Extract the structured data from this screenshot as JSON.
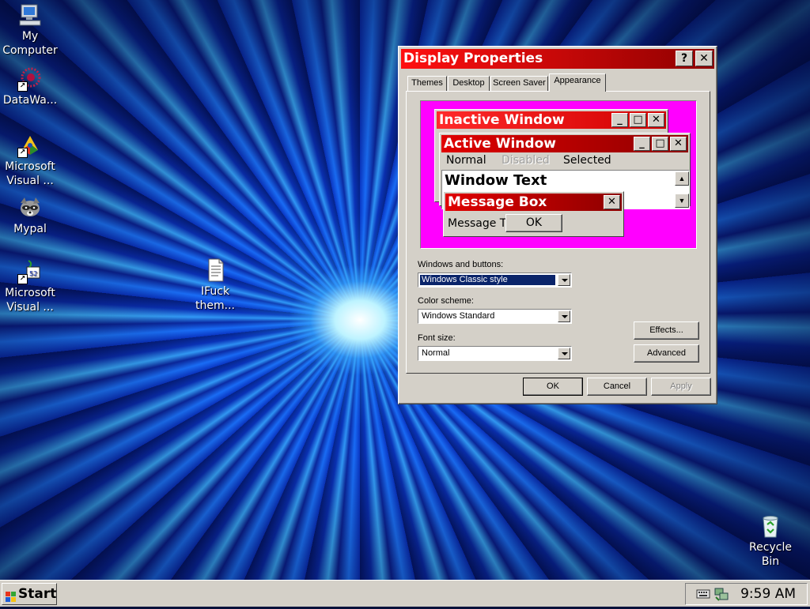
{
  "desktop": {
    "icons": [
      {
        "label": "My Computer",
        "icon": "my-computer-icon"
      },
      {
        "label": "DataWa...",
        "icon": "datawatch-icon"
      },
      {
        "label": "Microsoft Visual ...",
        "icon": "visual-studio-icon"
      },
      {
        "label": "Mypal",
        "icon": "mypal-raccoon-icon"
      },
      {
        "label": "Microsoft Visual ...",
        "icon": "visual-foxpro-icon"
      },
      {
        "label": "IFuck them...",
        "icon": "text-document-icon"
      },
      {
        "label": "Recycle Bin",
        "icon": "recycle-bin-icon"
      }
    ]
  },
  "dialog": {
    "title": "Display Properties",
    "help_btn": "?",
    "close_btn": "X",
    "tabs": [
      "Themes",
      "Desktop",
      "Screen Saver",
      "Appearance"
    ],
    "active_tab": "Appearance",
    "preview": {
      "inactive_title": "Inactive Window",
      "active_title": "Active Window",
      "menu_normal": "Normal",
      "menu_disabled": "Disabled",
      "menu_selected": "Selected",
      "window_text": "Window Text",
      "msgbox_title": "Message Box",
      "msgbox_text": "Message T",
      "msgbox_ok": "OK"
    },
    "windows_buttons_label": "Windows and buttons:",
    "windows_buttons_value": "Windows Classic style",
    "color_scheme_label": "Color scheme:",
    "color_scheme_value": "Windows Standard",
    "font_size_label": "Font size:",
    "font_size_value": "Normal",
    "effects_btn": "Effects...",
    "advanced_btn": "Advanced",
    "ok_btn": "OK",
    "cancel_btn": "Cancel",
    "apply_btn": "Apply"
  },
  "taskbar": {
    "start_label": "Start",
    "clock": "9:59 AM"
  },
  "colors": {
    "title_active_start": "#ff1010",
    "title_active_end": "#8e0000",
    "preview_background": "#ff00ff",
    "face": "#d4d0c8",
    "selection": "#0a246a"
  }
}
